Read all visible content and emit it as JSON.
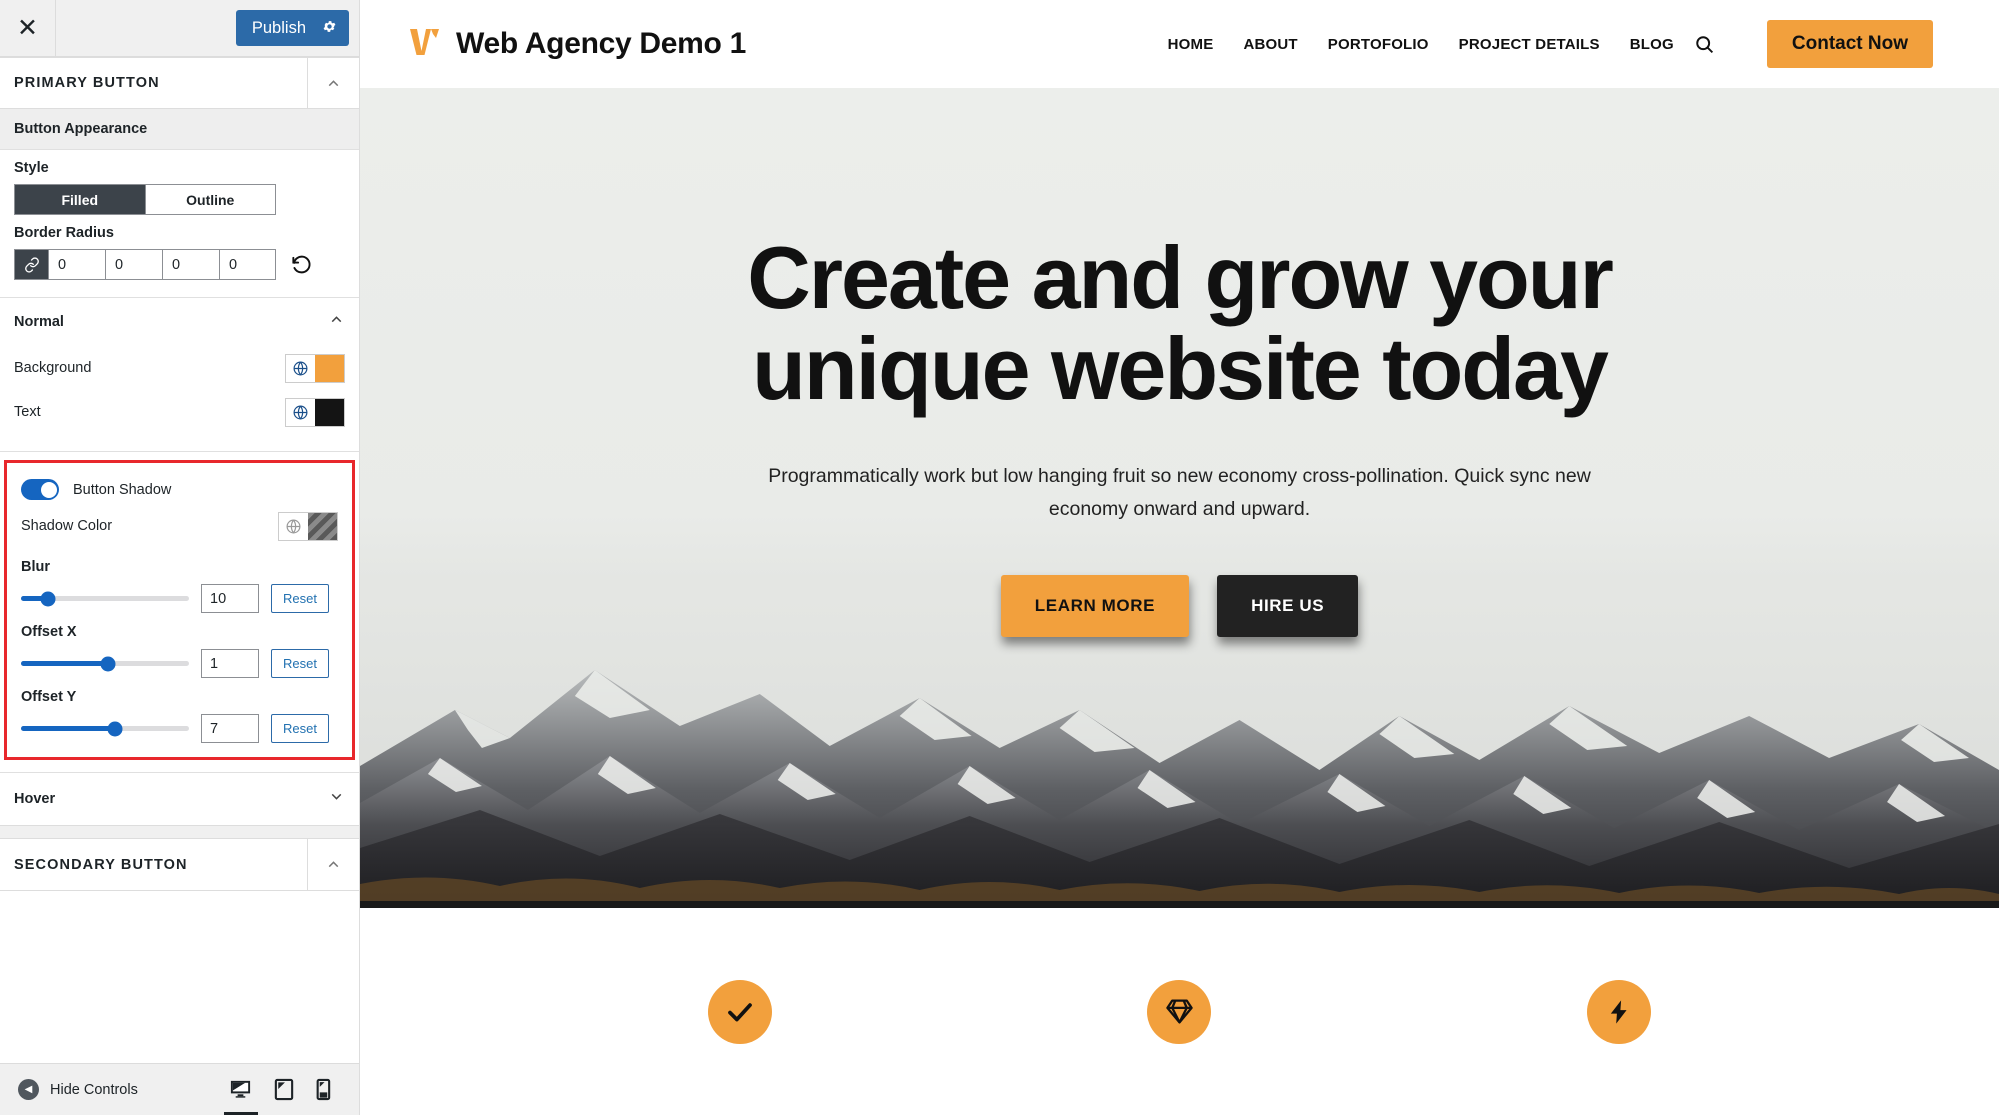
{
  "sidebar": {
    "topbar": {
      "close_icon": "close-icon",
      "publish_label": "Publish",
      "gear_icon": "gear-icon"
    },
    "panel": {
      "title": "PRIMARY BUTTON",
      "collapse_icon": "chevron-up-icon"
    },
    "appearance": {
      "section_label": "Button Appearance",
      "style_label": "Style",
      "style_options": [
        "Filled",
        "Outline"
      ],
      "style_selected": "Filled",
      "border_radius_label": "Border Radius",
      "border_radius_link_icon": "link-icon",
      "border_radius_values": [
        "0",
        "0",
        "0",
        "0"
      ],
      "border_radius_reset_icon": "undo-icon"
    },
    "normal": {
      "label": "Normal",
      "collapse_icon": "chevron-up-icon",
      "background_label": "Background",
      "background_color": "#F2A03D",
      "text_label": "Text",
      "text_color": "#141414",
      "globe_icon": "globe-icon"
    },
    "shadow": {
      "toggle_label": "Button Shadow",
      "toggle_on": true,
      "shadow_color_label": "Shadow Color",
      "shadow_color_swatch": "transparent-stripes",
      "sliders": [
        {
          "label": "Blur",
          "value": "10",
          "percent": 16,
          "reset_label": "Reset"
        },
        {
          "label": "Offset X",
          "value": "1",
          "percent": 52,
          "reset_label": "Reset"
        },
        {
          "label": "Offset Y",
          "value": "7",
          "percent": 56,
          "reset_label": "Reset"
        }
      ],
      "highlight_color": "#e8272c"
    },
    "hover": {
      "label": "Hover",
      "collapse_icon": "chevron-down-icon"
    },
    "secondary_panel": {
      "title": "SECONDARY BUTTON",
      "collapse_icon": "chevron-up-icon"
    },
    "bottombar": {
      "hide_controls_label": "Hide Controls",
      "back_icon": "caret-left-icon",
      "devices": [
        {
          "name": "desktop",
          "icon": "desktop-icon",
          "active": true
        },
        {
          "name": "tablet",
          "icon": "tablet-icon",
          "active": false
        },
        {
          "name": "mobile",
          "icon": "mobile-icon",
          "active": false
        }
      ]
    }
  },
  "preview": {
    "header": {
      "logo_icon": "w-logo-icon",
      "brand_name": "Web Agency Demo 1",
      "nav": [
        "HOME",
        "ABOUT",
        "PORTOFOLIO",
        "PROJECT DETAILS",
        "BLOG"
      ],
      "search_icon": "search-icon",
      "cta_label": "Contact Now",
      "cta_color": "#F2A03D"
    },
    "hero": {
      "title": "Create and grow your unique website today",
      "subtitle": "Programmatically work but low hanging fruit so new economy cross-pollination. Quick sync new economy onward and upward.",
      "primary_btn": "LEARN MORE",
      "secondary_btn": "HIRE US"
    },
    "features": [
      {
        "icon": "check-icon"
      },
      {
        "icon": "diamond-icon"
      },
      {
        "icon": "bolt-icon"
      }
    ]
  }
}
